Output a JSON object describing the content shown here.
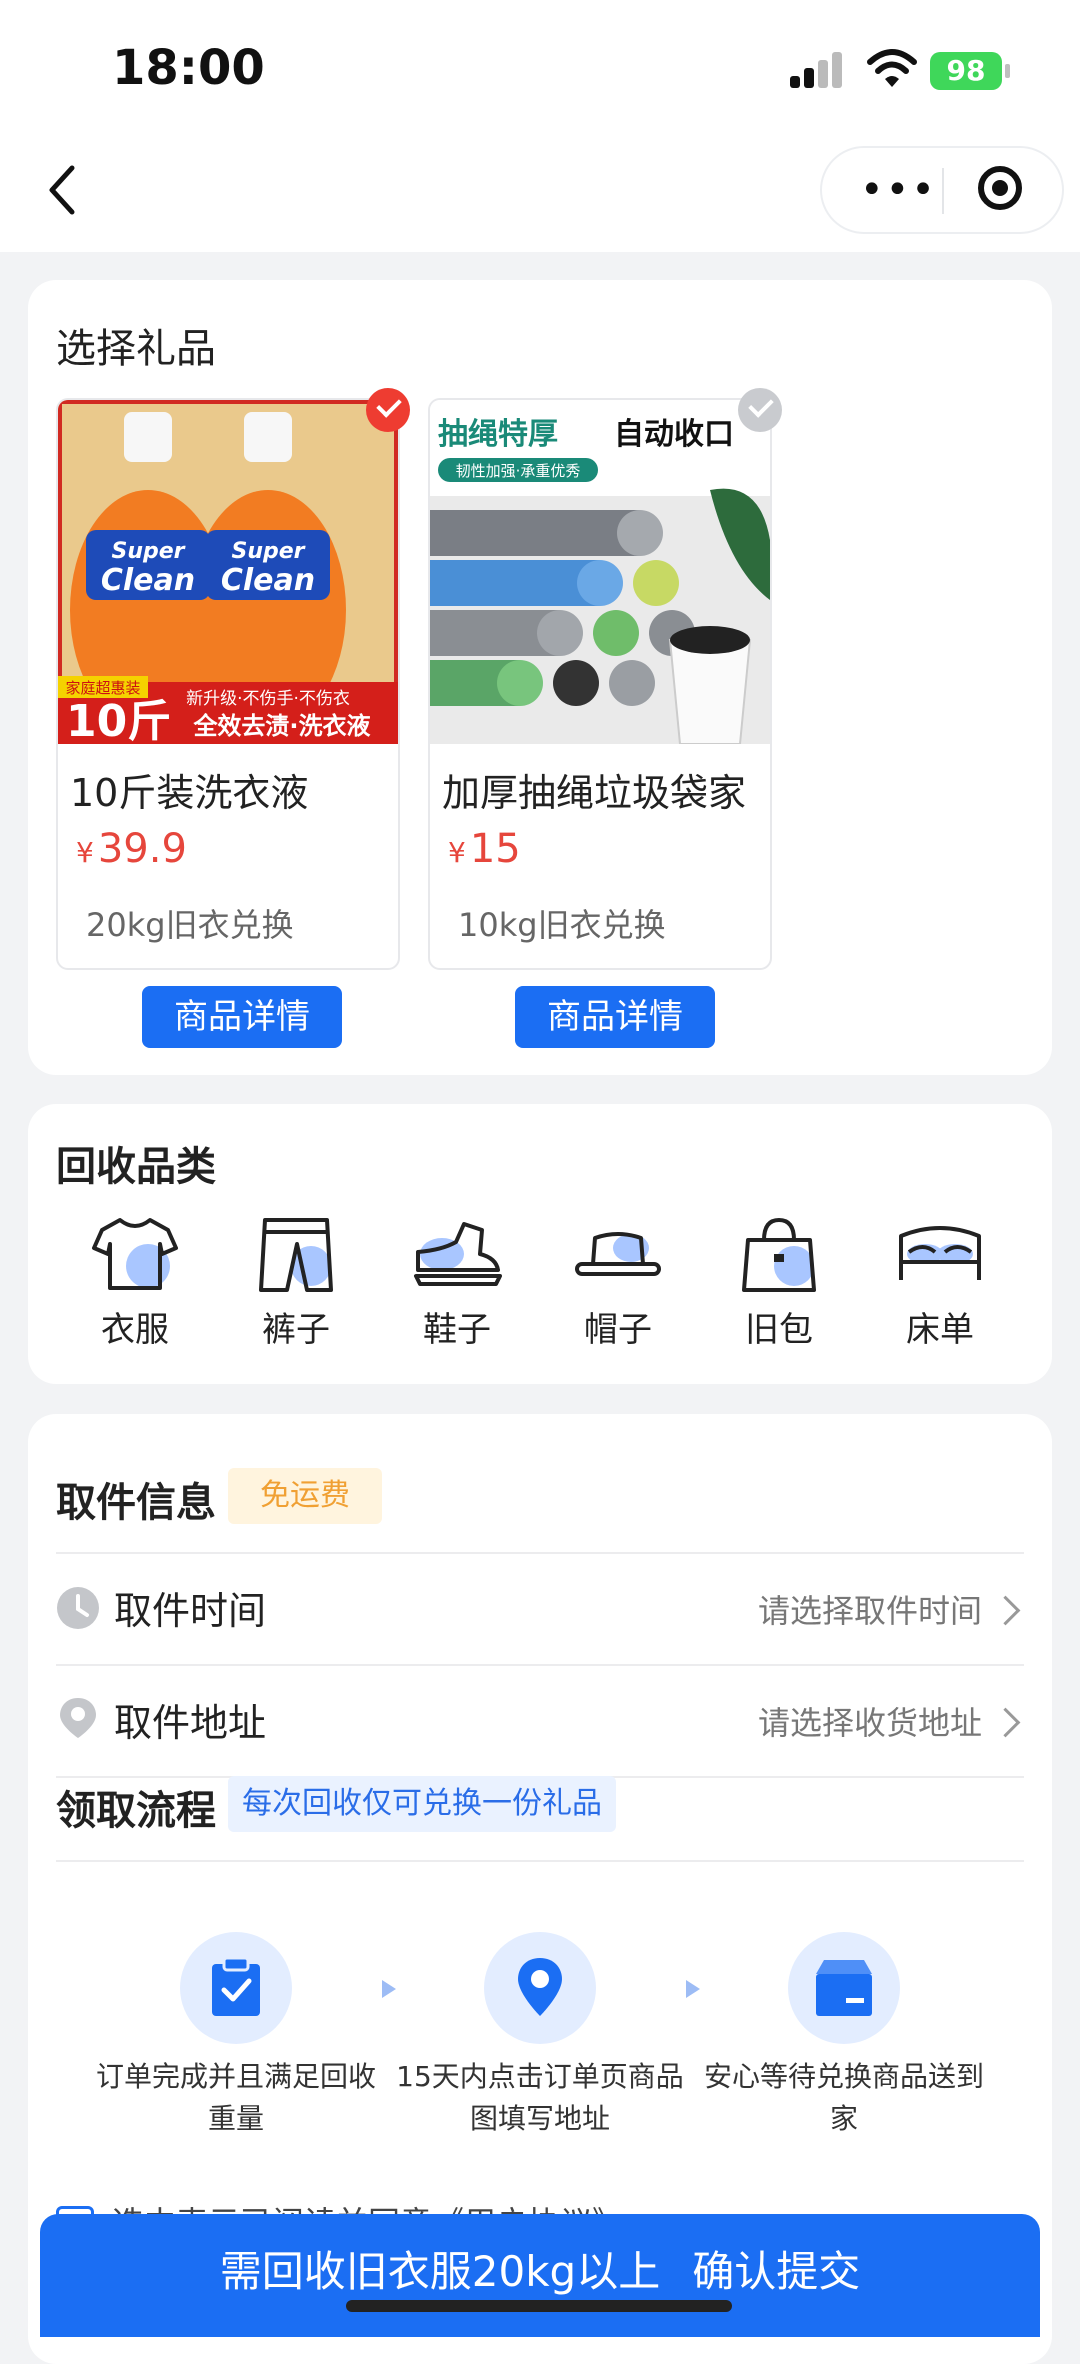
{
  "status_bar": {
    "time": "18:00",
    "battery": "98"
  },
  "gifts_section": {
    "title": "选择礼品",
    "items": [
      {
        "name": "10斤装洗衣液",
        "currency": "¥",
        "price": "39.9",
        "exchange": "20kg旧衣兑换",
        "detail_label": "商品详情",
        "selected": true,
        "image": {
          "brand_line1": "Super",
          "brand_line2": "Clean",
          "tag": "全效去渍·洗衣液",
          "sub_tag": "新升级·不伤手·不伤衣",
          "big": "10斤",
          "corner": "家庭超惠装"
        }
      },
      {
        "name": "加厚抽绳垃圾袋家",
        "currency": "¥",
        "price": "15",
        "exchange": "10kg旧衣兑换",
        "detail_label": "商品详情",
        "selected": false,
        "image": {
          "headline_left": "抽绳特厚",
          "headline_right": "自动收口",
          "sub": "韧性加强·承重优秀"
        }
      }
    ]
  },
  "categories_section": {
    "title": "回收品类",
    "items": [
      {
        "label": "衣服",
        "icon": "tshirt-icon"
      },
      {
        "label": "裤子",
        "icon": "pants-icon"
      },
      {
        "label": "鞋子",
        "icon": "shoe-icon"
      },
      {
        "label": "帽子",
        "icon": "hat-icon"
      },
      {
        "label": "旧包",
        "icon": "bag-icon"
      },
      {
        "label": "床单",
        "icon": "bed-icon"
      }
    ]
  },
  "pickup_section": {
    "title": "取件信息",
    "free_tag": "免运费",
    "time_label": "取件时间",
    "time_placeholder": "请选择取件时间",
    "address_label": "取件地址",
    "address_placeholder": "请选择收货地址",
    "flow_title": "领取流程",
    "flow_note": "每次回收仅可兑换一份礼品",
    "steps": [
      {
        "line1": "订单完成并且满足回收",
        "line2": "重量",
        "icon": "clipboard-check-icon"
      },
      {
        "line1": "15天内点击订单页商品",
        "line2": "图填写地址",
        "icon": "location-pin-icon"
      },
      {
        "line1": "安心等待兑换商品送到",
        "line2": "家",
        "icon": "package-box-icon"
      }
    ],
    "agreement": "选中表示已阅读并同意《用户协议》"
  },
  "submit": {
    "requirement": "需回收旧衣服20kg以上",
    "confirm": "确认提交"
  },
  "colors": {
    "accent": "#1b6ef3",
    "price": "#e6463c",
    "free_tag": "#f0a033"
  }
}
